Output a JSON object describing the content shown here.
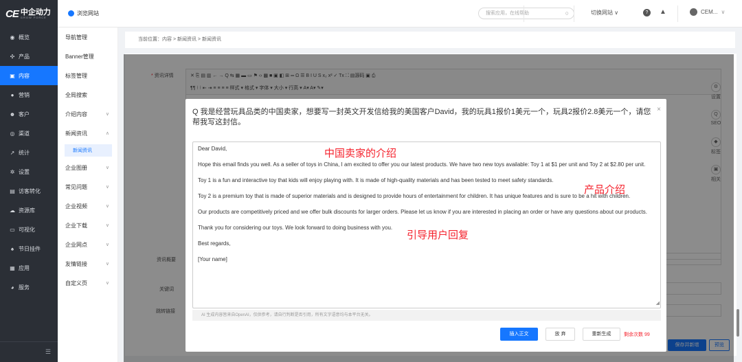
{
  "logo": {
    "mark": "CE",
    "cn": "中企动力",
    "en": "GROW FORCE"
  },
  "sidebar": {
    "items": [
      {
        "label": "概览",
        "icon": "dashboard-icon",
        "glyph": "◉"
      },
      {
        "label": "产品",
        "icon": "product-icon",
        "glyph": "✣"
      },
      {
        "label": "内容",
        "icon": "content-icon",
        "glyph": "▣",
        "active": true
      },
      {
        "label": "营销",
        "icon": "marketing-icon",
        "glyph": "●"
      },
      {
        "label": "客户",
        "icon": "customer-icon",
        "glyph": "☻"
      },
      {
        "label": "渠道",
        "icon": "channel-icon",
        "glyph": "◎"
      },
      {
        "label": "统计",
        "icon": "stats-icon",
        "glyph": "↗"
      },
      {
        "label": "设置",
        "icon": "settings-icon",
        "glyph": "✲"
      },
      {
        "label": "访客转化",
        "icon": "visitor-icon",
        "glyph": "▤"
      },
      {
        "label": "资源库",
        "icon": "cloud-icon",
        "glyph": "☁"
      },
      {
        "label": "可视化",
        "icon": "monitor-icon",
        "glyph": "▭"
      },
      {
        "label": "节日挂件",
        "icon": "pendant-icon",
        "glyph": "♠"
      },
      {
        "label": "应用",
        "icon": "apps-icon",
        "glyph": "▦"
      },
      {
        "label": "服务",
        "icon": "service-icon",
        "glyph": "◕"
      }
    ],
    "collapse_glyph": "☰"
  },
  "topbar": {
    "browse_site": "浏览网站",
    "search_placeholder": "搜索应用，在线帮助",
    "switch_site": "切换网站 ∨",
    "user": "CEM...",
    "help_glyph": "?",
    "bell_glyph": "🔔"
  },
  "submenu": {
    "items": [
      {
        "label": "导航管理",
        "chev": ""
      },
      {
        "label": "Banner管理",
        "chev": ""
      },
      {
        "label": "标签管理",
        "chev": ""
      },
      {
        "label": "全局搜索",
        "chev": ""
      },
      {
        "label": "介绍内容",
        "chev": "∨"
      },
      {
        "label": "新闻资讯",
        "chev": "∧"
      }
    ],
    "active_child": "新闻资讯",
    "items_after": [
      {
        "label": "企业图册",
        "chev": "∨"
      },
      {
        "label": "常见问题",
        "chev": "∨"
      },
      {
        "label": "企业视频",
        "chev": "∨"
      },
      {
        "label": "企业下载",
        "chev": "∨"
      },
      {
        "label": "企业网点",
        "chev": "∨"
      },
      {
        "label": "友情链接",
        "chev": "∨"
      },
      {
        "label": "自定义页",
        "chev": "∨"
      }
    ]
  },
  "breadcrumb": "当前位置：内容 > 新闻资讯 > 新闻资讯",
  "form": {
    "detail_label": "资讯详情",
    "summary_label": "资讯概要",
    "keywords_label": "关键词",
    "jump_label": "跳转链接",
    "toolbar_row1": "✕  ⎘  ▤  ▥  ←  →  Q  ⇆  ▦  ▬  ▭  ⚑  ‹›  ▩  ■  ▣  ◧  ⊞  ═  Ω  ☰  B  I  U  S  x₂  x²  ✓  Tx  ⛶  ▤源码  ▣  ⎙",
    "toolbar_row2": "¶¶  ⁝  ⁝  ⇤  ⇥  ≡  ≡  ≡  ≡  样式 ▾   格式 ▾   字体 ▾   大小 ▾   行高 ▾   A▾  A▾  ✎▾",
    "save_button": "保存并新增",
    "preview_button": "预览"
  },
  "right_tools": [
    {
      "label": "设置",
      "glyph": "⚙"
    },
    {
      "label": "SEO",
      "glyph": "Q"
    },
    {
      "label": "标签",
      "glyph": "◆"
    },
    {
      "label": "相关",
      "glyph": "▣"
    }
  ],
  "modal": {
    "question": "Q 我是经营玩具品类的中国卖家，想要写一封英文开发信给我的美国客户David，我的玩具1报价1美元一个，玩具2报价2.8美元一个，请您帮我写这封信。",
    "close_glyph": "×",
    "paragraphs": [
      "Dear David,",
      "Hope this email finds you well. As a seller of toys in China, I am excited to offer you our latest products. We have two new toys available: Toy 1 at $1 per unit and Toy 2 at $2.80 per unit.",
      "Toy 1 is a fun and interactive toy that kids will enjoy playing with. It is made of high-quality materials and has been tested to meet safety standards.",
      "Toy 2 is a premium toy that is made of superior materials and is designed to provide hours of entertainment for children. It has unique features and is sure to be a hit with children.",
      "Our products are competitively priced and we offer bulk discounts for larger orders. Please let us know if you are interested in placing an order or have any questions about our products.",
      "Thank you for considering our toys. We look forward to doing business with you.",
      "Best regards,",
      "[Your name]"
    ],
    "annotations": {
      "intro": "中国卖家的介绍",
      "product": "产品介绍",
      "guide": "引导用户回复"
    },
    "disclaimer": "AI 生成内容皆来自OpenAI，仅供参考，请自行判断是否引用，所有文字语意均与本平台无关。",
    "insert_button": "插入正文",
    "discard_button": "放 弃",
    "regenerate_button": "重新生成",
    "remaining": "剩余次数 99"
  }
}
